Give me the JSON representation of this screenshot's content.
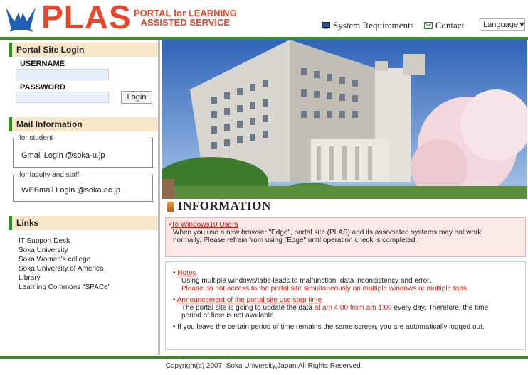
{
  "header": {
    "logo_text": "PLAS",
    "tagline_line1": "PORTAL for LEARNING",
    "tagline_line2": "ASSISTED SERVICE",
    "system_requirements": "System Requirements",
    "contact": "Contact",
    "language": "Language"
  },
  "login": {
    "title": "Portal Site Login",
    "username_label": "USERNAME",
    "password_label": "PASSWORD",
    "login_button": "Login"
  },
  "mail": {
    "title": "Mail Information",
    "student_legend": "for student",
    "student_link": "Gmail Login @soka-u.jp",
    "faculty_legend": "for faculty and staff",
    "faculty_link": "WEBmail Login @soka.ac.jp"
  },
  "links": {
    "title": "Links",
    "items": [
      "IT Support Desk",
      "Soka University",
      "Soka Women's college",
      "Soka University of America",
      "Library",
      "Learning Commons \"SPACe\""
    ]
  },
  "info": {
    "title": "INFORMATION",
    "notice1_link": "To Windows10 Users",
    "notice1_text_1": "When you use a new browser \"Edge\", portal site (PLAS) and its associated systems may not work",
    "notice1_text_2": "normally. Please refrain from using \"Edge\" until operation check is completed.",
    "notes_link": "Notes",
    "notes_text": "Using multiple windows/tabs leads to malfunction, data inconsistency and error.",
    "notes_red": "Please do not access to the portal site simultaneously on multiple windows or multiple tabs.",
    "stop_link": "Announcement of the portal site use stop time",
    "stop_text_a": "The portal site is going to update the data ",
    "stop_red": "at am 4:00 from am 1:00",
    "stop_text_b": " every day. Therefore, the time",
    "stop_text_c": "period of time is not available.",
    "logout_text": "If you leave the certain period of time remains the same screen, you are automatically logged out."
  },
  "footer": {
    "copyright": "Copyright(c) 2007, Soka University,Japan All Rights Reserved."
  },
  "colors": {
    "brand_red": "#e8452a",
    "brand_green": "#3a8a28",
    "section_bg": "#f7e7c8",
    "notice_bg": "#fde8e8"
  }
}
